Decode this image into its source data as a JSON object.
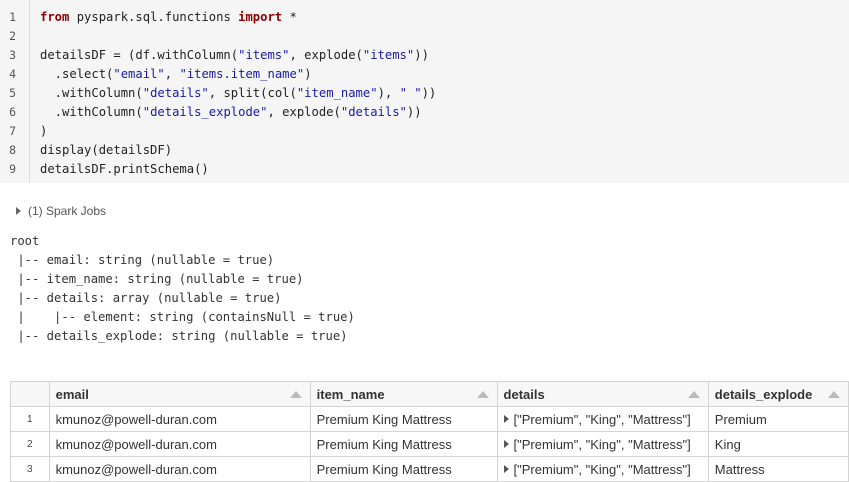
{
  "code": {
    "lines": [
      {
        "num": "1",
        "parts": [
          {
            "t": "from",
            "c": "kw"
          },
          {
            "t": " pyspark.sql.functions ",
            "c": ""
          },
          {
            "t": "import",
            "c": "kw"
          },
          {
            "t": " *",
            "c": ""
          }
        ]
      },
      {
        "num": "2",
        "parts": []
      },
      {
        "num": "3",
        "parts": [
          {
            "t": "detailsDF = (df.withColumn(",
            "c": ""
          },
          {
            "t": "\"items\"",
            "c": "str"
          },
          {
            "t": ", explode(",
            "c": ""
          },
          {
            "t": "\"items\"",
            "c": "str"
          },
          {
            "t": "))",
            "c": ""
          }
        ]
      },
      {
        "num": "4",
        "parts": [
          {
            "t": "  .select(",
            "c": ""
          },
          {
            "t": "\"email\"",
            "c": "str"
          },
          {
            "t": ", ",
            "c": ""
          },
          {
            "t": "\"items.item_name\"",
            "c": "str"
          },
          {
            "t": ")",
            "c": ""
          }
        ]
      },
      {
        "num": "5",
        "parts": [
          {
            "t": "  .withColumn(",
            "c": ""
          },
          {
            "t": "\"details\"",
            "c": "str"
          },
          {
            "t": ", split(col(",
            "c": ""
          },
          {
            "t": "\"item_name\"",
            "c": "str"
          },
          {
            "t": "), ",
            "c": ""
          },
          {
            "t": "\" \"",
            "c": "str"
          },
          {
            "t": "))",
            "c": ""
          }
        ]
      },
      {
        "num": "6",
        "parts": [
          {
            "t": "  .withColumn(",
            "c": ""
          },
          {
            "t": "\"details_explode\"",
            "c": "str"
          },
          {
            "t": ", explode(",
            "c": ""
          },
          {
            "t": "\"details\"",
            "c": "str"
          },
          {
            "t": "))",
            "c": ""
          }
        ]
      },
      {
        "num": "7",
        "parts": [
          {
            "t": ")",
            "c": ""
          }
        ]
      },
      {
        "num": "8",
        "parts": [
          {
            "t": "display(detailsDF)",
            "c": ""
          }
        ]
      },
      {
        "num": "9",
        "parts": [
          {
            "t": "detailsDF.printSchema()",
            "c": ""
          }
        ]
      }
    ]
  },
  "spark_jobs": {
    "label": "(1) Spark Jobs"
  },
  "schema": {
    "lines": [
      "root",
      " |-- email: string (nullable = true)",
      " |-- item_name: string (nullable = true)",
      " |-- details: array (nullable = true)",
      " |    |-- element: string (containsNull = true)",
      " |-- details_explode: string (nullable = true)"
    ]
  },
  "table": {
    "columns": [
      "email",
      "item_name",
      "details",
      "details_explode"
    ],
    "rows": [
      {
        "num": "1",
        "email": "kmunoz@powell-duran.com",
        "item_name": "Premium King Mattress",
        "details": "[\"Premium\", \"King\", \"Mattress\"]",
        "details_explode": "Premium"
      },
      {
        "num": "2",
        "email": "kmunoz@powell-duran.com",
        "item_name": "Premium King Mattress",
        "details": "[\"Premium\", \"King\", \"Mattress\"]",
        "details_explode": "King"
      },
      {
        "num": "3",
        "email": "kmunoz@powell-duran.com",
        "item_name": "Premium King Mattress",
        "details": "[\"Premium\", \"King\", \"Mattress\"]",
        "details_explode": "Mattress"
      }
    ]
  }
}
